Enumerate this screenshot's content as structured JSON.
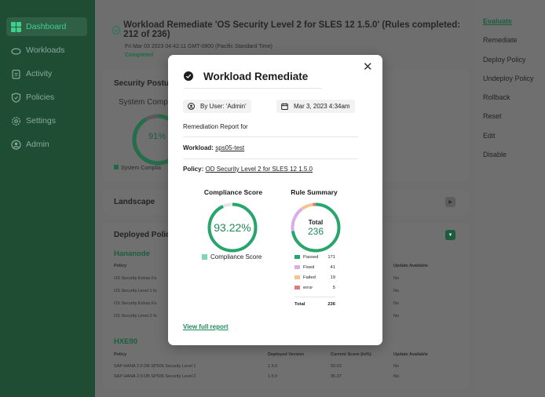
{
  "sidebar": {
    "items": [
      {
        "label": "Dashboard",
        "icon": "dashboard-icon",
        "active": true
      },
      {
        "label": "Workloads",
        "icon": "cloud-icon"
      },
      {
        "label": "Activity",
        "icon": "clipboard-icon"
      },
      {
        "label": "Policies",
        "icon": "shield-icon"
      },
      {
        "label": "Settings",
        "icon": "gear-icon"
      },
      {
        "label": "Admin",
        "icon": "user-circle-icon"
      }
    ]
  },
  "header": {
    "title": "Workload Remediate 'OS Security Level 2 for SLES 12 1.5.0' (Rules completed: 212 of 236)",
    "date": "Fri Mar 03 2023 04:42:11 GMT-0800 (Pacific Standard Time)",
    "status": "Completed"
  },
  "background": {
    "security_posture": {
      "title": "Security Postu",
      "subtitle": "System Comp",
      "percent": "91%",
      "legend": "System Complia"
    },
    "landscape": {
      "title": "Landscape"
    },
    "deployed": {
      "title": "Deployed Polic",
      "group1": {
        "name": "Hananode",
        "col_policy": "Policy",
        "col_update": "Update Available",
        "rows": [
          {
            "policy": "OS Security Extras Fo",
            "update": "No"
          },
          {
            "policy": "OS Security Level 1 fo",
            "update": "No"
          },
          {
            "policy": "OS Security Extras Fo",
            "update": "No"
          },
          {
            "policy": "OS Security Level 2 fo",
            "update": "No"
          }
        ]
      },
      "group2": {
        "name": "HXE90",
        "col_policy": "Policy",
        "col_version": "Deployed Version",
        "col_score": "Current Score (In%)",
        "col_update": "Update Available",
        "rows": [
          {
            "policy": "SAP HANA 2.0 DB SP505 Security Level 1",
            "version": "1.5.0",
            "score": "93.63",
            "update": "No"
          },
          {
            "policy": "SAP HANA 2.0 DB SP505 Security Level 2",
            "version": "1.5.0",
            "score": "95.37",
            "update": "No"
          }
        ]
      }
    }
  },
  "right_panel": {
    "items": [
      "Evaluate",
      "Remediate",
      "Deploy Policy",
      "Undeploy Policy",
      "Rollback",
      "Reset",
      "Edit",
      "Disable"
    ]
  },
  "modal": {
    "title": "Workload Remediate",
    "by_user": "By User: 'Admin'",
    "date": "Mar 3, 2023 4:34am",
    "report_for": "Remediation Report for",
    "workload_label": "Workload:",
    "workload_value": "sps05-test",
    "policy_label": "Policy:",
    "policy_value": "OD Security Level 2 for SLES 12 1.5.0",
    "compliance": {
      "title": "Compliance Score",
      "value": "93.22%",
      "legend": "Compliance Score",
      "fraction": 0.9322
    },
    "rule_summary": {
      "title": "Rule Summary",
      "total_label": "Total",
      "total_value": "236",
      "rows": [
        {
          "label": "Passed",
          "value": "171",
          "color": "#27a56d"
        },
        {
          "label": "Fixed",
          "value": "41",
          "color": "#d9aee8"
        },
        {
          "label": "Failed",
          "value": "19",
          "color": "#f2c58f"
        },
        {
          "label": "error",
          "value": "5",
          "color": "#e07b7b"
        }
      ],
      "total_row_label": "Total",
      "total_row_value": "236"
    },
    "view_full_report": "View full report"
  },
  "colors": {
    "accent": "#27a56d",
    "sidebar": "#1f4d34"
  }
}
